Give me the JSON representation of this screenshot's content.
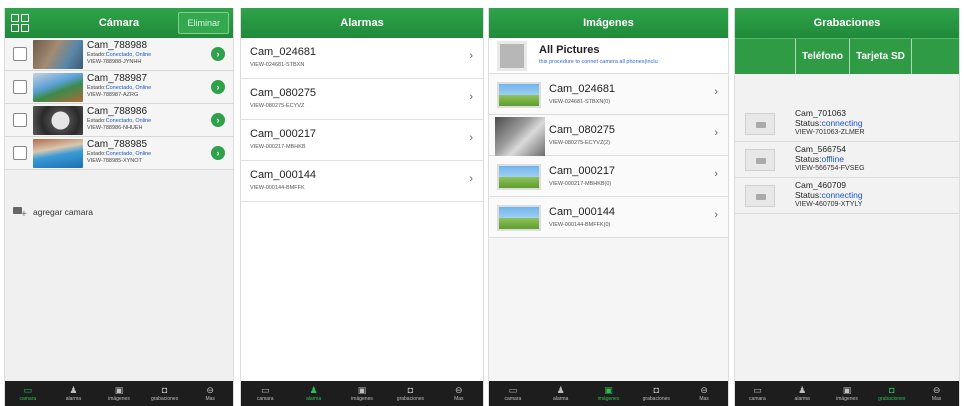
{
  "bottom_nav": [
    {
      "icon": "camera-icon",
      "glyph": "▭",
      "label": "camara"
    },
    {
      "icon": "bell-icon",
      "glyph": "♟",
      "label": "alarma"
    },
    {
      "icon": "image-icon",
      "glyph": "▣",
      "label": "imágenes"
    },
    {
      "icon": "play-icon",
      "glyph": "◘",
      "label": "grabaciones"
    },
    {
      "icon": "more-icon",
      "glyph": "⊖",
      "label": "Mas"
    }
  ],
  "camara": {
    "title": "Cámara",
    "delete_label": "Eliminar",
    "status_prefix": "Estado:",
    "status_value": "Conectado, Online",
    "add_label": "agregar camara",
    "cameras": [
      {
        "name": "Cam_788988",
        "id": "VIEW-788988-JYNHH"
      },
      {
        "name": "Cam_788987",
        "id": "VIEW-788987-AZRG"
      },
      {
        "name": "Cam_788986",
        "id": "VIEW-788986-NHUEH"
      },
      {
        "name": "Cam_788985",
        "id": "VIEW-788985-XYNOT"
      }
    ]
  },
  "alarmas": {
    "title": "Alarmas",
    "items": [
      {
        "name": "Cam_024681",
        "id": "VIEW-024681-STBXN"
      },
      {
        "name": "Cam_080275",
        "id": "VIEW-080275-ECYVZ"
      },
      {
        "name": "Cam_000217",
        "id": "VIEW-000217-MBHKB"
      },
      {
        "name": "Cam_000144",
        "id": "VIEW-000144-BMFFK"
      }
    ]
  },
  "imagenes": {
    "title": "Imágenes",
    "all_pictures": "All Pictures",
    "all_pictures_sub": "this procedure to connet camera all phones(inclu",
    "items": [
      {
        "name": "Cam_024681",
        "id": "VIEW-024681-STBXN(0)"
      },
      {
        "name": "Cam_080275",
        "id": "VIEW-080275-ECYVZ(2)"
      },
      {
        "name": "Cam_000217",
        "id": "VIEW-000217-MBHKB(0)"
      },
      {
        "name": "Cam_000144",
        "id": "VIEW-000144-BMFFK(0)"
      }
    ]
  },
  "grabaciones": {
    "title": "Grabaciones",
    "tabs": [
      "Teléfono",
      "Tarjeta SD"
    ],
    "status_prefix": "Status:",
    "items": [
      {
        "name": "Cam_701063",
        "status": "connecting",
        "id": "VIEW-701063-ZLMER"
      },
      {
        "name": "Cam_566754",
        "status": "offline",
        "id": "VIEW-566754-FVSEG"
      },
      {
        "name": "Cam_460709",
        "status": "connecting",
        "id": "VIEW-460709-XTYLY"
      }
    ]
  },
  "colors": {
    "accent": "#2a9e45",
    "active_tab": "#2dbf54",
    "link_blue": "#1a56c4"
  }
}
